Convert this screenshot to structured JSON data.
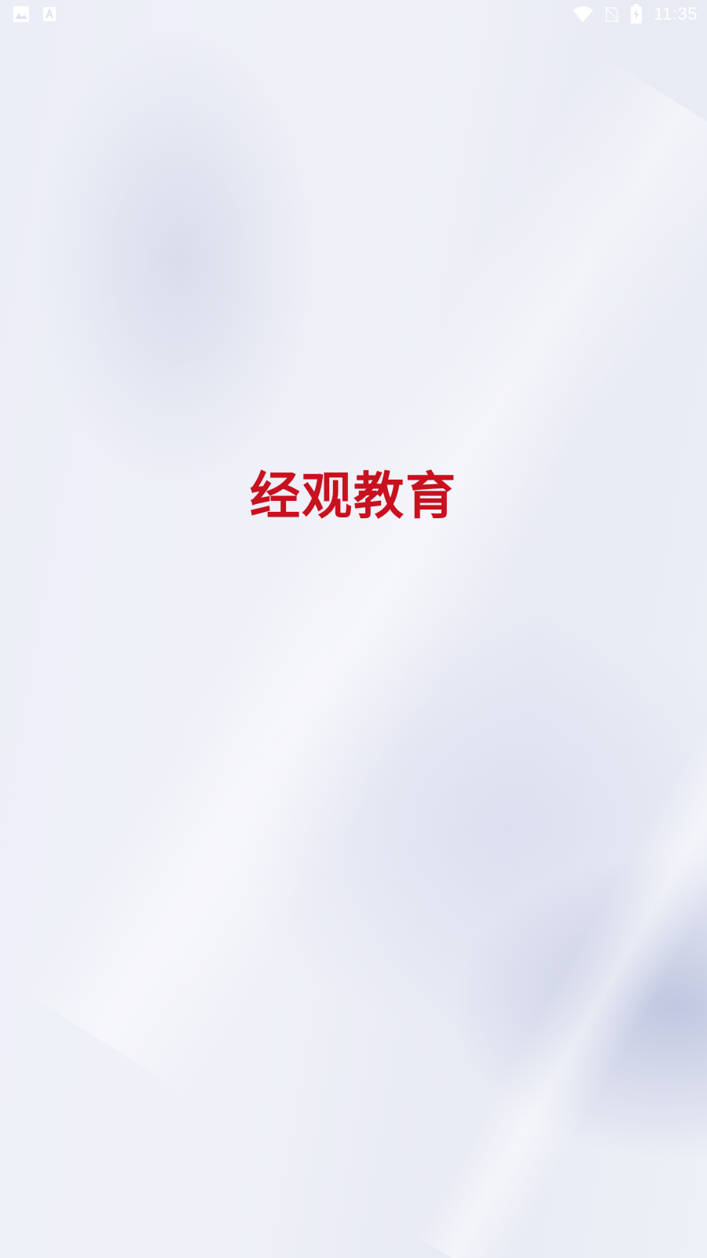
{
  "status_bar": {
    "time": "11:35",
    "left_icons": [
      "image-icon",
      "keyboard-a-icon"
    ],
    "right_icons": [
      "wifi-icon",
      "no-sim-icon",
      "battery-charging-icon"
    ]
  },
  "splash": {
    "title": "经观教育",
    "title_color": "#c8101e"
  },
  "colors": {
    "background": "#eef0f8",
    "status_text": "#ffffff"
  }
}
